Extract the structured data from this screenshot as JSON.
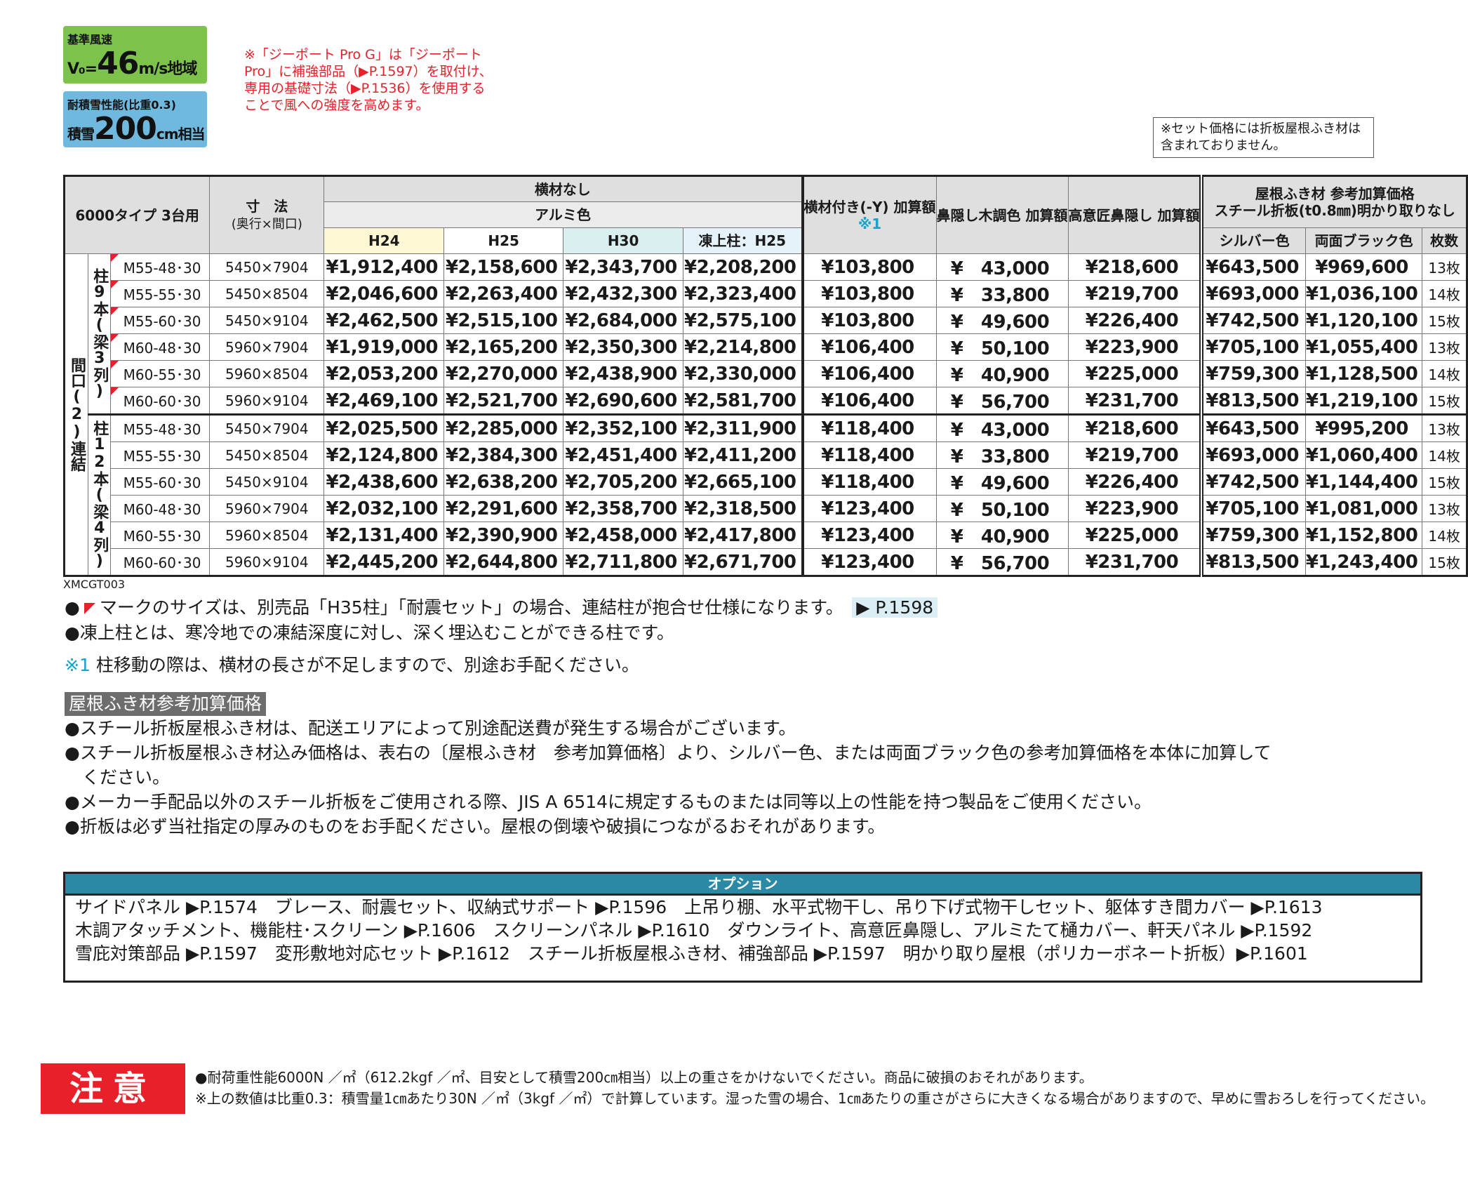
{
  "badges": {
    "wind_label": "基準風速",
    "wind_prefix": "V₀=",
    "wind_value": "46",
    "wind_unit": "m/s",
    "wind_suffix": "地域",
    "snow_label": "耐積雪性能(比重0.3)",
    "snow_prefix": "積雪",
    "snow_value": "200",
    "snow_unit": "cm",
    "snow_suffix": "相当"
  },
  "red_note": "※「ジーポート Pro G」は「ジーポート Pro」に補強部品（▶P.1597）を取付け、専用の基礎寸法（▶P.1536）を使用することで風への強度を高めます。",
  "set_note": "※セット価格には折板屋根ふき材は含まれておりません。",
  "table": {
    "type_label": "6000タイプ 3台用",
    "dim_label": "寸　法",
    "dim_sub": "(奥行×間口)",
    "no_beam": "横材なし",
    "alumi": "アルミ色",
    "cols": [
      "H24",
      "H25",
      "H30",
      "凍上柱：H25"
    ],
    "beam_add": "横材付き(-Y) 加算額",
    "beam_note": "※1",
    "wood_add": "鼻隠し木調色 加算額",
    "design_add": "高意匠鼻隠し 加算額",
    "roof_title1": "屋根ふき材 参考加算価格",
    "roof_title2": "スチール折板(t0.8㎜)明かり取りなし",
    "roof_cols": [
      "シルバー色",
      "両面ブラック色",
      "枚数"
    ],
    "outer_label": "間口(2)連結",
    "group1_label": "柱9本(梁3列)",
    "group2_label": "柱12本(梁4列)",
    "group1": [
      {
        "model": "M55-48･30",
        "dim": "5450×7904",
        "h24": "¥1,912,400",
        "h25": "¥2,158,600",
        "h30": "¥2,343,700",
        "tou": "¥2,208,200",
        "beam": "¥103,800",
        "wood": "¥　43,000",
        "design": "¥218,600",
        "silver": "¥643,500",
        "black": "¥969,600",
        "count": "13枚"
      },
      {
        "model": "M55-55･30",
        "dim": "5450×8504",
        "h24": "¥2,046,600",
        "h25": "¥2,263,400",
        "h30": "¥2,432,300",
        "tou": "¥2,323,400",
        "beam": "¥103,800",
        "wood": "¥　33,800",
        "design": "¥219,700",
        "silver": "¥693,000",
        "black": "¥1,036,100",
        "count": "14枚"
      },
      {
        "model": "M55-60･30",
        "dim": "5450×9104",
        "h24": "¥2,462,500",
        "h25": "¥2,515,100",
        "h30": "¥2,684,000",
        "tou": "¥2,575,100",
        "beam": "¥103,800",
        "wood": "¥　49,600",
        "design": "¥226,400",
        "silver": "¥742,500",
        "black": "¥1,120,100",
        "count": "15枚"
      },
      {
        "model": "M60-48･30",
        "dim": "5960×7904",
        "h24": "¥1,919,000",
        "h25": "¥2,165,200",
        "h30": "¥2,350,300",
        "tou": "¥2,214,800",
        "beam": "¥106,400",
        "wood": "¥　50,100",
        "design": "¥223,900",
        "silver": "¥705,100",
        "black": "¥1,055,400",
        "count": "13枚"
      },
      {
        "model": "M60-55･30",
        "dim": "5960×8504",
        "h24": "¥2,053,200",
        "h25": "¥2,270,000",
        "h30": "¥2,438,900",
        "tou": "¥2,330,000",
        "beam": "¥106,400",
        "wood": "¥　40,900",
        "design": "¥225,000",
        "silver": "¥759,300",
        "black": "¥1,128,500",
        "count": "14枚"
      },
      {
        "model": "M60-60･30",
        "dim": "5960×9104",
        "h24": "¥2,469,100",
        "h25": "¥2,521,700",
        "h30": "¥2,690,600",
        "tou": "¥2,581,700",
        "beam": "¥106,400",
        "wood": "¥　56,700",
        "design": "¥231,700",
        "silver": "¥813,500",
        "black": "¥1,219,100",
        "count": "15枚"
      }
    ],
    "group2": [
      {
        "model": "M55-48･30",
        "dim": "5450×7904",
        "h24": "¥2,025,500",
        "h25": "¥2,285,000",
        "h30": "¥2,352,100",
        "tou": "¥2,311,900",
        "beam": "¥118,400",
        "wood": "¥　43,000",
        "design": "¥218,600",
        "silver": "¥643,500",
        "black": "¥995,200",
        "count": "13枚"
      },
      {
        "model": "M55-55･30",
        "dim": "5450×8504",
        "h24": "¥2,124,800",
        "h25": "¥2,384,300",
        "h30": "¥2,451,400",
        "tou": "¥2,411,200",
        "beam": "¥118,400",
        "wood": "¥　33,800",
        "design": "¥219,700",
        "silver": "¥693,000",
        "black": "¥1,060,400",
        "count": "14枚"
      },
      {
        "model": "M55-60･30",
        "dim": "5450×9104",
        "h24": "¥2,438,600",
        "h25": "¥2,638,200",
        "h30": "¥2,705,200",
        "tou": "¥2,665,100",
        "beam": "¥118,400",
        "wood": "¥　49,600",
        "design": "¥226,400",
        "silver": "¥742,500",
        "black": "¥1,144,400",
        "count": "15枚"
      },
      {
        "model": "M60-48･30",
        "dim": "5960×7904",
        "h24": "¥2,032,100",
        "h25": "¥2,291,600",
        "h30": "¥2,358,700",
        "tou": "¥2,318,500",
        "beam": "¥123,400",
        "wood": "¥　50,100",
        "design": "¥223,900",
        "silver": "¥705,100",
        "black": "¥1,081,000",
        "count": "13枚"
      },
      {
        "model": "M60-55･30",
        "dim": "5960×8504",
        "h24": "¥2,131,400",
        "h25": "¥2,390,900",
        "h30": "¥2,458,000",
        "tou": "¥2,417,800",
        "beam": "¥123,400",
        "wood": "¥　40,900",
        "design": "¥225,000",
        "silver": "¥759,300",
        "black": "¥1,152,800",
        "count": "14枚"
      },
      {
        "model": "M60-60･30",
        "dim": "5960×9104",
        "h24": "¥2,445,200",
        "h25": "¥2,644,800",
        "h30": "¥2,711,800",
        "tou": "¥2,671,700",
        "beam": "¥123,400",
        "wood": "¥　56,700",
        "design": "¥231,700",
        "silver": "¥813,500",
        "black": "¥1,243,400",
        "count": "15枚"
      }
    ]
  },
  "code": "XMCGT003",
  "notes": {
    "flag_note_before": "●",
    "flag_note_text": "マークのサイズは、別売品「H35柱」「耐震セット」の場合、連結柱が抱合せ仕様になります。",
    "flag_note_page": "▶ P.1598",
    "tou_note": "●凍上柱とは、寒冷地での凍結深度に対し、深く埋込むことができる柱です。",
    "star_mark": "※1",
    "star_note": "柱移動の際は、横材の長さが不足しますので、別途お手配ください。",
    "roof_heading": "屋根ふき材参考加算価格",
    "roof_lines": [
      "●スチール折板屋根ふき材は、配送エリアによって別途配送費が発生する場合がございます。",
      "●スチール折板屋根ふき材込み価格は、表右の〔屋根ふき材　参考加算価格〕より、シルバー色、または両面ブラック色の参考加算価格を本体に加算して",
      "　ください。",
      "●メーカー手配品以外のスチール折板をご使用される際、JIS A 6514に規定するものまたは同等以上の性能を持つ製品をご使用ください。",
      "●折板は必ず当社指定の厚みのものをお手配ください。屋根の倒壊や破損につながるおそれがあります。"
    ]
  },
  "options": {
    "title": "オプション",
    "lines": [
      "サイドパネル ▶P.1574　ブレース、耐震セット、収納式サポート ▶P.1596　上吊り棚、水平式物干し、吊り下げ式物干しセット、躯体すき間カバー ▶P.1613",
      "木調アタッチメント、機能柱･スクリーン ▶P.1606　スクリーンパネル ▶P.1610　ダウンライト、高意匠鼻隠し、アルミたて樋カバー、軒天パネル ▶P.1592",
      "雪庇対策部品 ▶P.1597　変形敷地対応セット ▶P.1612　スチール折板屋根ふき材、補強部品 ▶P.1597　明かり取り屋根（ポリカーボネート折板）▶P.1601"
    ]
  },
  "caution": {
    "label": "注意",
    "lines": [
      "●耐荷重性能6000N ／㎡（612.2kgf ／㎡、目安として積雪200㎝相当）以上の重さをかけないでください。商品に破損のおそれがあります。",
      "※上の数値は比重0.3：積雪量1㎝あたり30N ／㎡（3kgf ／㎡）で計算しています。湿った雪の場合、1㎝あたりの重さがさらに大きくなる場合がありますので、早めに雪おろしを行ってください。"
    ]
  },
  "colors": {
    "accent_red": "#e8202a",
    "wind_green": "#7dc24a",
    "snow_blue": "#6fb9df",
    "option_teal": "#2a8aa6"
  }
}
